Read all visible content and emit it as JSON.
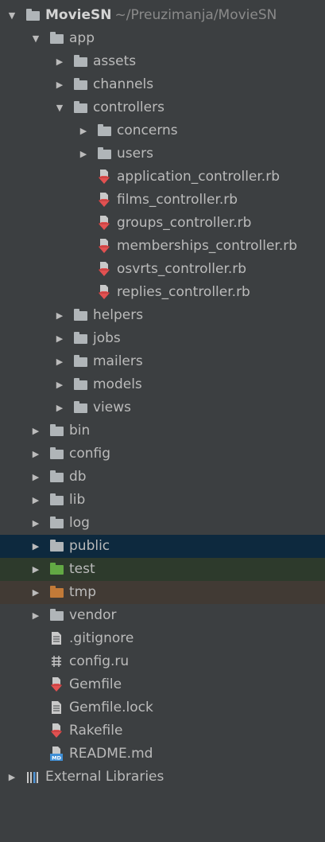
{
  "project": {
    "name": "MovieSN",
    "path": "~/Preuzimanja/MovieSN"
  },
  "colors": {
    "background": "#3c3f41",
    "text": "#bbbbbb",
    "folder": "#b0b5b8",
    "test_folder": "#62a844",
    "excluded_folder": "#c27a38",
    "ruby_file": "#e25151",
    "selected_row": "#0d293e"
  },
  "tree": [
    {
      "label": "MovieSN",
      "path_text": "~/Preuzimanja/MovieSN",
      "depth": 0,
      "kind": "folder",
      "arrow": "down",
      "icon": "folder-icon"
    },
    {
      "label": "app",
      "depth": 1,
      "kind": "folder",
      "arrow": "down",
      "icon": "folder-icon"
    },
    {
      "label": "assets",
      "depth": 2,
      "kind": "folder",
      "arrow": "right",
      "icon": "folder-icon"
    },
    {
      "label": "channels",
      "depth": 2,
      "kind": "folder",
      "arrow": "right",
      "icon": "folder-icon"
    },
    {
      "label": "controllers",
      "depth": 2,
      "kind": "folder",
      "arrow": "down",
      "icon": "folder-icon"
    },
    {
      "label": "concerns",
      "depth": 3,
      "kind": "folder",
      "arrow": "right",
      "icon": "folder-icon"
    },
    {
      "label": "users",
      "depth": 3,
      "kind": "folder",
      "arrow": "right",
      "icon": "folder-icon"
    },
    {
      "label": "application_controller.rb",
      "depth": 3,
      "kind": "file",
      "icon": "ruby-file-icon"
    },
    {
      "label": "films_controller.rb",
      "depth": 3,
      "kind": "file",
      "icon": "ruby-file-icon"
    },
    {
      "label": "groups_controller.rb",
      "depth": 3,
      "kind": "file",
      "icon": "ruby-file-icon"
    },
    {
      "label": "memberships_controller.rb",
      "depth": 3,
      "kind": "file",
      "icon": "ruby-file-icon"
    },
    {
      "label": "osvrts_controller.rb",
      "depth": 3,
      "kind": "file",
      "icon": "ruby-file-icon"
    },
    {
      "label": "replies_controller.rb",
      "depth": 3,
      "kind": "file",
      "icon": "ruby-file-icon"
    },
    {
      "label": "helpers",
      "depth": 2,
      "kind": "folder",
      "arrow": "right",
      "icon": "folder-icon"
    },
    {
      "label": "jobs",
      "depth": 2,
      "kind": "folder",
      "arrow": "right",
      "icon": "folder-icon"
    },
    {
      "label": "mailers",
      "depth": 2,
      "kind": "folder",
      "arrow": "right",
      "icon": "folder-icon"
    },
    {
      "label": "models",
      "depth": 2,
      "kind": "folder",
      "arrow": "right",
      "icon": "folder-icon"
    },
    {
      "label": "views",
      "depth": 2,
      "kind": "folder",
      "arrow": "right",
      "icon": "folder-icon"
    },
    {
      "label": "bin",
      "depth": 1,
      "kind": "folder",
      "arrow": "right",
      "icon": "folder-icon"
    },
    {
      "label": "config",
      "depth": 1,
      "kind": "folder",
      "arrow": "right",
      "icon": "folder-icon"
    },
    {
      "label": "db",
      "depth": 1,
      "kind": "folder",
      "arrow": "right",
      "icon": "folder-icon"
    },
    {
      "label": "lib",
      "depth": 1,
      "kind": "folder",
      "arrow": "right",
      "icon": "folder-icon"
    },
    {
      "label": "log",
      "depth": 1,
      "kind": "folder",
      "arrow": "right",
      "icon": "folder-icon"
    },
    {
      "label": "public",
      "depth": 1,
      "kind": "folder",
      "arrow": "right",
      "icon": "folder-icon",
      "state": "selected"
    },
    {
      "label": "test",
      "depth": 1,
      "kind": "folder",
      "arrow": "right",
      "icon": "test-folder-icon",
      "state": "test"
    },
    {
      "label": "tmp",
      "depth": 1,
      "kind": "folder",
      "arrow": "right",
      "icon": "excluded-folder-icon",
      "state": "excluded"
    },
    {
      "label": "vendor",
      "depth": 1,
      "kind": "folder",
      "arrow": "right",
      "icon": "folder-icon"
    },
    {
      "label": ".gitignore",
      "depth": 1,
      "kind": "file",
      "icon": "text-file-icon"
    },
    {
      "label": "config.ru",
      "depth": 1,
      "kind": "file",
      "icon": "config-file-icon"
    },
    {
      "label": "Gemfile",
      "depth": 1,
      "kind": "file",
      "icon": "ruby-file-icon"
    },
    {
      "label": "Gemfile.lock",
      "depth": 1,
      "kind": "file",
      "icon": "text-file-icon"
    },
    {
      "label": "Rakefile",
      "depth": 1,
      "kind": "file",
      "icon": "ruby-file-icon"
    },
    {
      "label": "README.md",
      "depth": 1,
      "kind": "file",
      "icon": "markdown-file-icon"
    },
    {
      "label": "External Libraries",
      "depth": 0,
      "kind": "libraries",
      "arrow": "right",
      "icon": "libraries-icon"
    }
  ]
}
